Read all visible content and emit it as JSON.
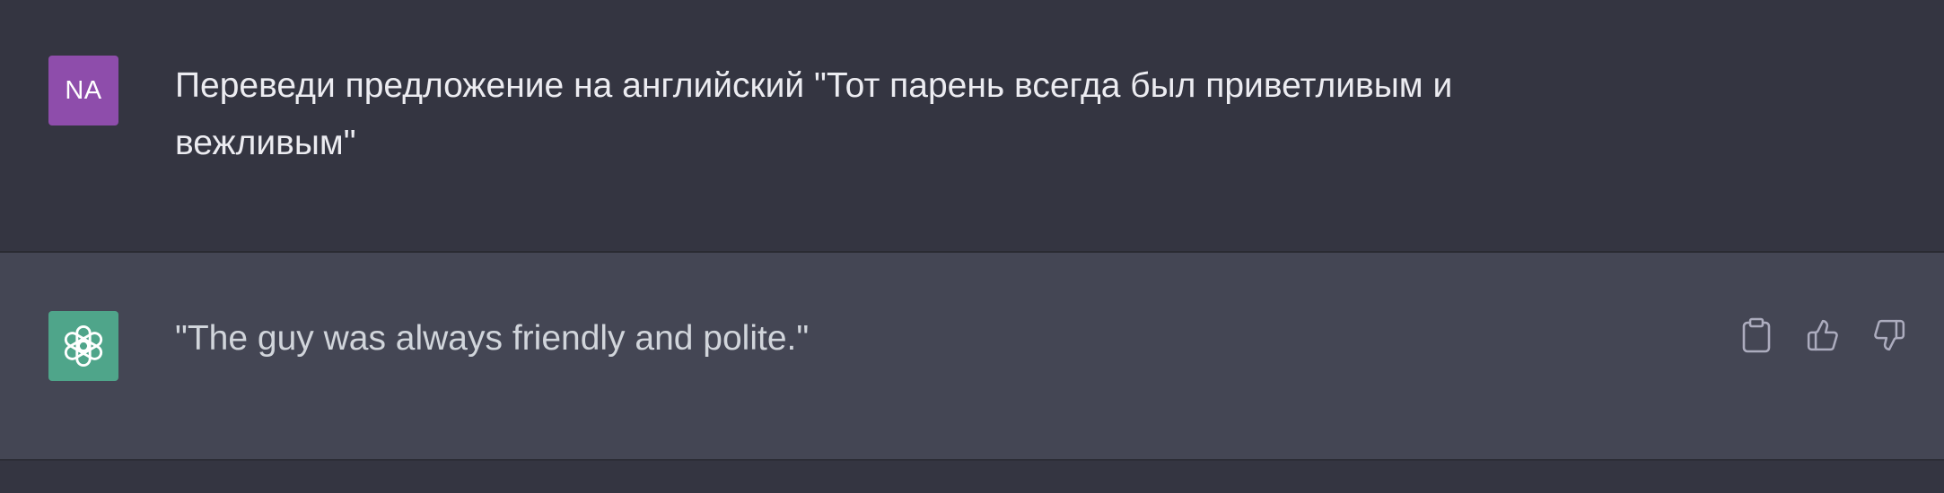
{
  "conversation": {
    "user_message": {
      "avatar_initials": "NA",
      "avatar_color": "#8e4dab",
      "text": "Переведи предложение на английский \"Тот парень всегда был приветливым и вежливым\""
    },
    "assistant_message": {
      "avatar_icon": "openai-logo-icon",
      "avatar_color": "#4fa58a",
      "text": "\"The guy was always friendly and polite.\"",
      "actions": [
        "copy-icon",
        "thumbs-up-icon",
        "thumbs-down-icon"
      ]
    }
  },
  "colors": {
    "user_row_bg": "#343541",
    "assistant_row_bg": "#444654",
    "text": "#ececf1"
  }
}
